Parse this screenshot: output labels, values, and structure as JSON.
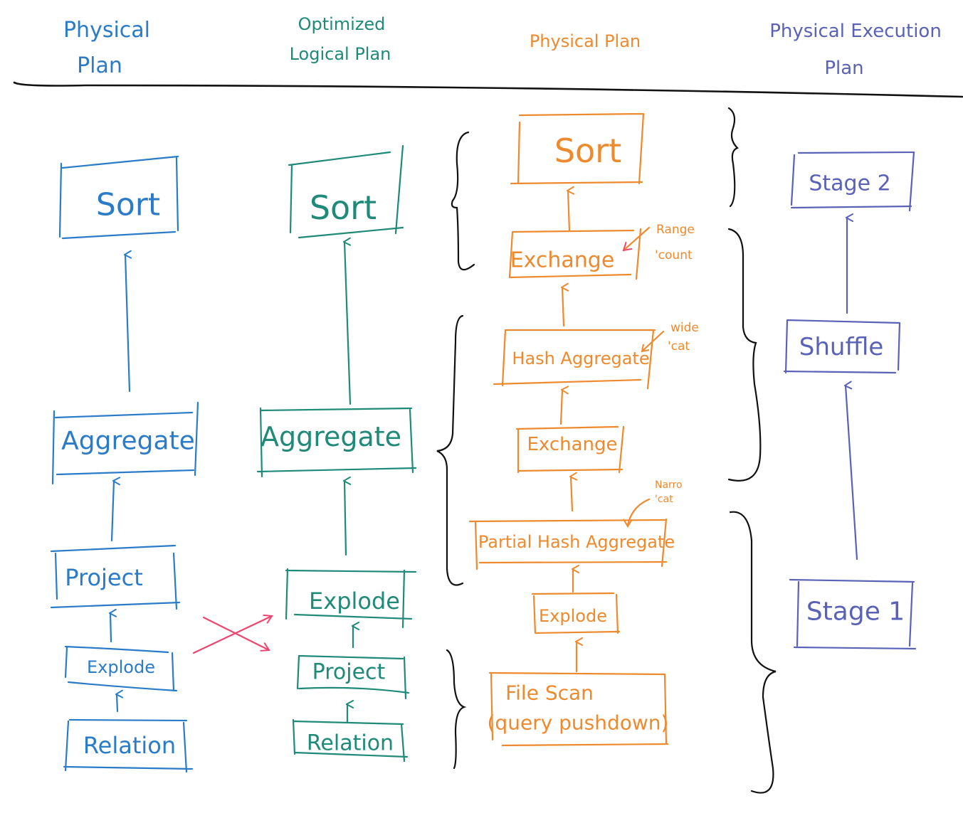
{
  "colors": {
    "physical_plan": "#2a7bc8",
    "optimized_logical_plan": "#1f8a78",
    "spark_physical_plan": "#ee8a2e",
    "physical_execution_plan": "#5a62b8",
    "swap_arrows": "#f0456e",
    "ink": "#111111"
  },
  "columns": [
    {
      "id": "physical",
      "header": [
        "Physical",
        "Plan"
      ],
      "color_key": "physical_plan",
      "nodes": [
        {
          "id": "sort",
          "label": "Sort"
        },
        {
          "id": "aggregate",
          "label": "Aggregate"
        },
        {
          "id": "project",
          "label": "Project"
        },
        {
          "id": "explode",
          "label": "Explode"
        },
        {
          "id": "relation",
          "label": "Relation"
        }
      ],
      "edges": [
        [
          "relation",
          "explode"
        ],
        [
          "explode",
          "project"
        ],
        [
          "project",
          "aggregate"
        ],
        [
          "aggregate",
          "sort"
        ]
      ]
    },
    {
      "id": "optimized",
      "header": [
        "Optimized",
        "Logical Plan"
      ],
      "color_key": "optimized_logical_plan",
      "nodes": [
        {
          "id": "sort",
          "label": "Sort"
        },
        {
          "id": "aggregate",
          "label": "Aggregate"
        },
        {
          "id": "explode",
          "label": "Explode"
        },
        {
          "id": "project",
          "label": "Project"
        },
        {
          "id": "relation",
          "label": "Relation"
        }
      ],
      "edges": [
        [
          "relation",
          "project"
        ],
        [
          "project",
          "explode"
        ],
        [
          "explode",
          "aggregate"
        ],
        [
          "aggregate",
          "sort"
        ]
      ]
    },
    {
      "id": "spark-physical",
      "header": [
        "Physical Plan"
      ],
      "color_key": "spark_physical_plan",
      "nodes": [
        {
          "id": "sort",
          "label": "Sort"
        },
        {
          "id": "exchange-range",
          "label": "Exchange"
        },
        {
          "id": "hash-aggregate",
          "label": "Hash Aggregate"
        },
        {
          "id": "exchange",
          "label": "Exchange"
        },
        {
          "id": "partial-hash-aggregate",
          "label": "Partial Hash Aggregate"
        },
        {
          "id": "explode",
          "label": "Explode"
        },
        {
          "id": "file-scan",
          "label": [
            "File Scan",
            "(query pushdown)"
          ]
        }
      ],
      "edges": [
        [
          "file-scan",
          "explode"
        ],
        [
          "explode",
          "partial-hash-aggregate"
        ],
        [
          "partial-hash-aggregate",
          "exchange"
        ],
        [
          "exchange",
          "hash-aggregate"
        ],
        [
          "hash-aggregate",
          "exchange-range"
        ],
        [
          "exchange-range",
          "sort"
        ]
      ],
      "annotations": [
        {
          "target": "exchange-range",
          "lines": [
            "Range",
            "'count"
          ]
        },
        {
          "target": "hash-aggregate",
          "lines": [
            "wide",
            "'cat"
          ]
        },
        {
          "target": "partial-hash-aggregate",
          "lines": [
            "Narro",
            "'cat"
          ]
        }
      ]
    },
    {
      "id": "execution",
      "header": [
        "Physical Execution",
        "Plan"
      ],
      "color_key": "physical_execution_plan",
      "nodes": [
        {
          "id": "stage-2",
          "label": "Stage 2"
        },
        {
          "id": "shuffle",
          "label": "Shuffle"
        },
        {
          "id": "stage-1",
          "label": "Stage 1"
        }
      ],
      "edges": [
        [
          "stage-1",
          "shuffle"
        ],
        [
          "shuffle",
          "stage-2"
        ]
      ]
    }
  ],
  "swap_annotation": {
    "description": "Explode and Project order swapped between plans"
  }
}
